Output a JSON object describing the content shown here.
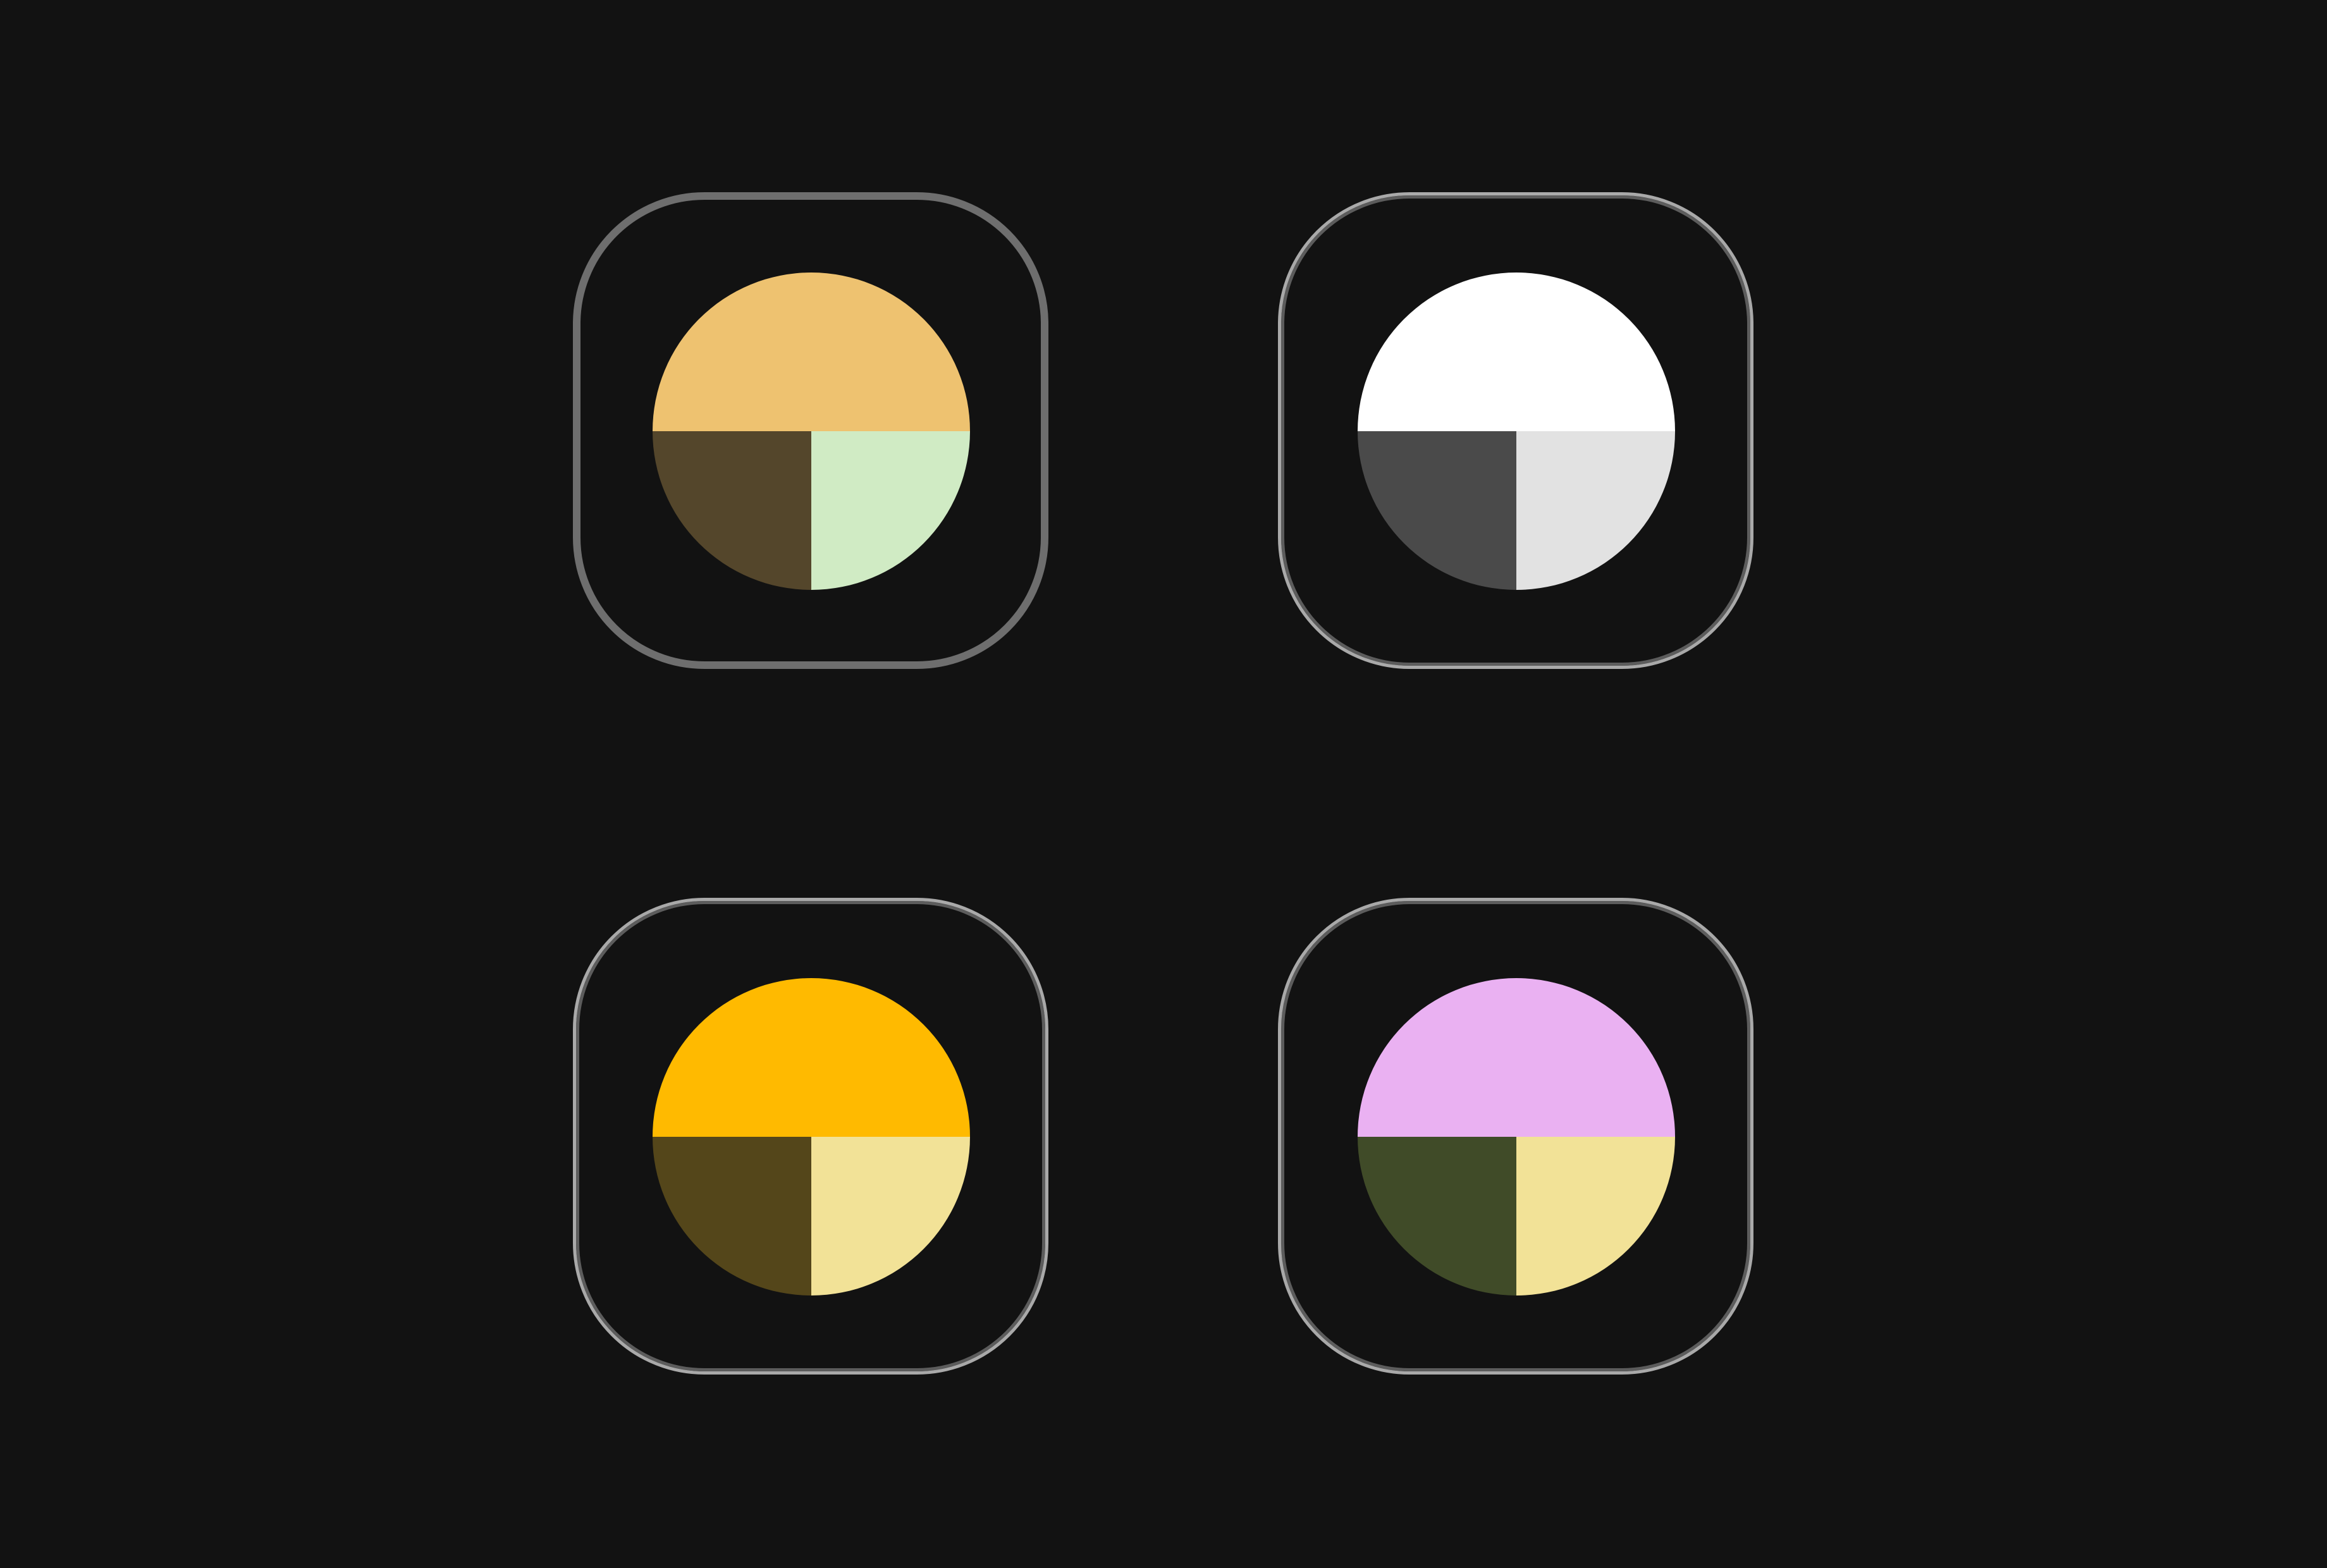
{
  "palettes": [
    {
      "id": "palette-1",
      "border_style": "single",
      "colors": {
        "primary": "#EEC270",
        "secondary": "#54462B",
        "tertiary": "#D0EBC4"
      }
    },
    {
      "id": "palette-2",
      "border_style": "double",
      "colors": {
        "primary": "#FFFFFF",
        "secondary": "#4A4A4A",
        "tertiary": "#E2E2E2"
      }
    },
    {
      "id": "palette-3",
      "border_style": "double",
      "colors": {
        "primary": "#FFBA00",
        "secondary": "#54461A",
        "tertiary": "#F2E297"
      }
    },
    {
      "id": "palette-4",
      "border_style": "double",
      "colors": {
        "primary": "#EAB1F2",
        "secondary": "#404B28",
        "tertiary": "#F2E297"
      }
    }
  ],
  "background_color": "#121212",
  "border_colors": {
    "outer": "#A9A9A9",
    "inner": "#5C5C5C",
    "single": "#6E6E6E"
  }
}
